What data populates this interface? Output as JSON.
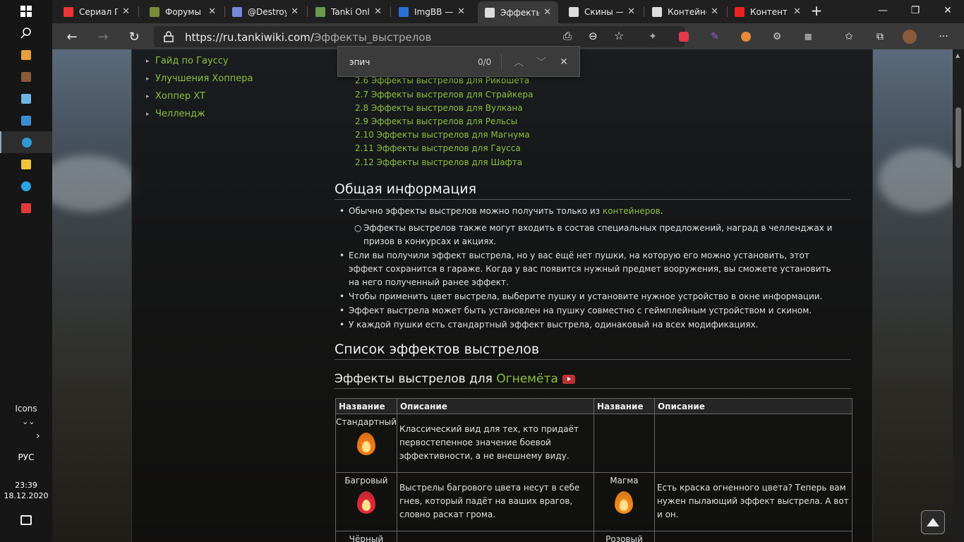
{
  "taskbar": {
    "icons_label": "Icons",
    "language": "РУС",
    "time": "23:39",
    "date": "18.12.2020",
    "apps": [
      {
        "icon": "paint-icon",
        "color": "#e7a03c"
      },
      {
        "icon": "game-icon",
        "color": "#8a5a3a"
      },
      {
        "icon": "notes-icon",
        "color": "#6fb5e0"
      },
      {
        "icon": "remote-icon",
        "color": "#3b8fd0"
      },
      {
        "icon": "edge-icon",
        "color": "#2e9bd6"
      },
      {
        "icon": "folder-icon",
        "color": "#f0c53a"
      },
      {
        "icon": "telegram-icon",
        "color": "#2aa3e0"
      },
      {
        "icon": "ai-icon",
        "color": "#e23b3b"
      }
    ]
  },
  "tabs": [
    {
      "label": "Сериал П",
      "icon": "star-icon",
      "color": "#e33"
    },
    {
      "label": "Форумы",
      "icon": "tank-icon",
      "color": "#7a8a3a"
    },
    {
      "label": "@Destroy",
      "icon": "discord-icon",
      "color": "#7289da"
    },
    {
      "label": "Tanki Onli",
      "icon": "tanki-icon",
      "color": "#6b9b4b"
    },
    {
      "label": "ImgBB —",
      "icon": "imgbb-icon",
      "color": "#2a72d6"
    },
    {
      "label": "Эффекты",
      "icon": "wiki-icon",
      "color": "#ddd",
      "active": true
    },
    {
      "label": "Скины —",
      "icon": "wiki-icon",
      "color": "#ddd"
    },
    {
      "label": "Контейне",
      "icon": "wiki-icon",
      "color": "#ddd"
    },
    {
      "label": "Контент",
      "icon": "youtube-icon",
      "color": "#e22"
    }
  ],
  "address": {
    "domain": "https://ru.tankiwiki.com/",
    "path": "Эффекты_выстрелов"
  },
  "find": {
    "query": "эпич",
    "count": "0/0"
  },
  "left_links": [
    "Гайд по Гауссу",
    "Улучшения Хоппера",
    "Хоппер XT",
    "Челлендж"
  ],
  "toc": [
    "2.4 Эфф",
    "2.5 Эфф",
    "2.6 Эффекты выстрелов для Рикошета",
    "2.7 Эффекты выстрелов для Страйкера",
    "2.8 Эффекты выстрелов для Вулкана",
    "2.9 Эффекты выстрелов для Рельсы",
    "2.10 Эффекты выстрелов для Магнума",
    "2.11 Эффекты выстрелов для Гаусса",
    "2.12 Эффекты выстрелов для Шафта"
  ],
  "section1": {
    "title": "Общая информация",
    "b1_text": "Обычно эффекты выстрелов можно получить только из ",
    "b1_link": "контейнеров",
    "b1_end": ".",
    "b1_sub": "Эффекты выстрелов также могут входить в состав специальных предложений, наград в челленджах и призов в конкурсах и акциях.",
    "b2": "Если вы получили эффект выстрела, но у вас ещё нет пушки, на которую его можно установить, этот эффект сохранится в гараже. Когда у вас появится нужный предмет вооружения, вы сможете установить на него полученный ранее эффект.",
    "b3": "Чтобы применить цвет выстрела, выберите пушку и установите нужное устройство в окне информации.",
    "b4": "Эффект выстрела может быть установлен на пушку совместно с геймплейным устройством и скином.",
    "b5": "У каждой пушки есть стандартный эффект выстрела, одинаковый на всех модификациях."
  },
  "section2": {
    "title": "Список эффектов выстрелов"
  },
  "section3": {
    "prefix": "Эффекты выстрелов для ",
    "link": "Огнемёта"
  },
  "table": {
    "headers": [
      "Название",
      "Описание",
      "Название",
      "Описание"
    ],
    "rows": [
      {
        "name1": "Стандартный",
        "desc1": "Классический вид для тех, кто придаёт первостепенное значение боевой эффективности, а не внешнему виду.",
        "color1": "#f57c1a",
        "name2": "",
        "desc2": ""
      },
      {
        "name1": "Багровый",
        "desc1": "Выстрелы багрового цвета несут в себе гнев, который падёт на ваших врагов, словно раскат грома.",
        "color1": "#e2293a",
        "name2": "Магма",
        "desc2": "Есть краска огненного цвета? Теперь вам нужен пылающий эффект выстрела. А вот и он.",
        "color2": "#f58a1e"
      },
      {
        "name1": "Чёрный",
        "desc1": "",
        "name2": "Розовый",
        "desc2": ""
      }
    ]
  }
}
